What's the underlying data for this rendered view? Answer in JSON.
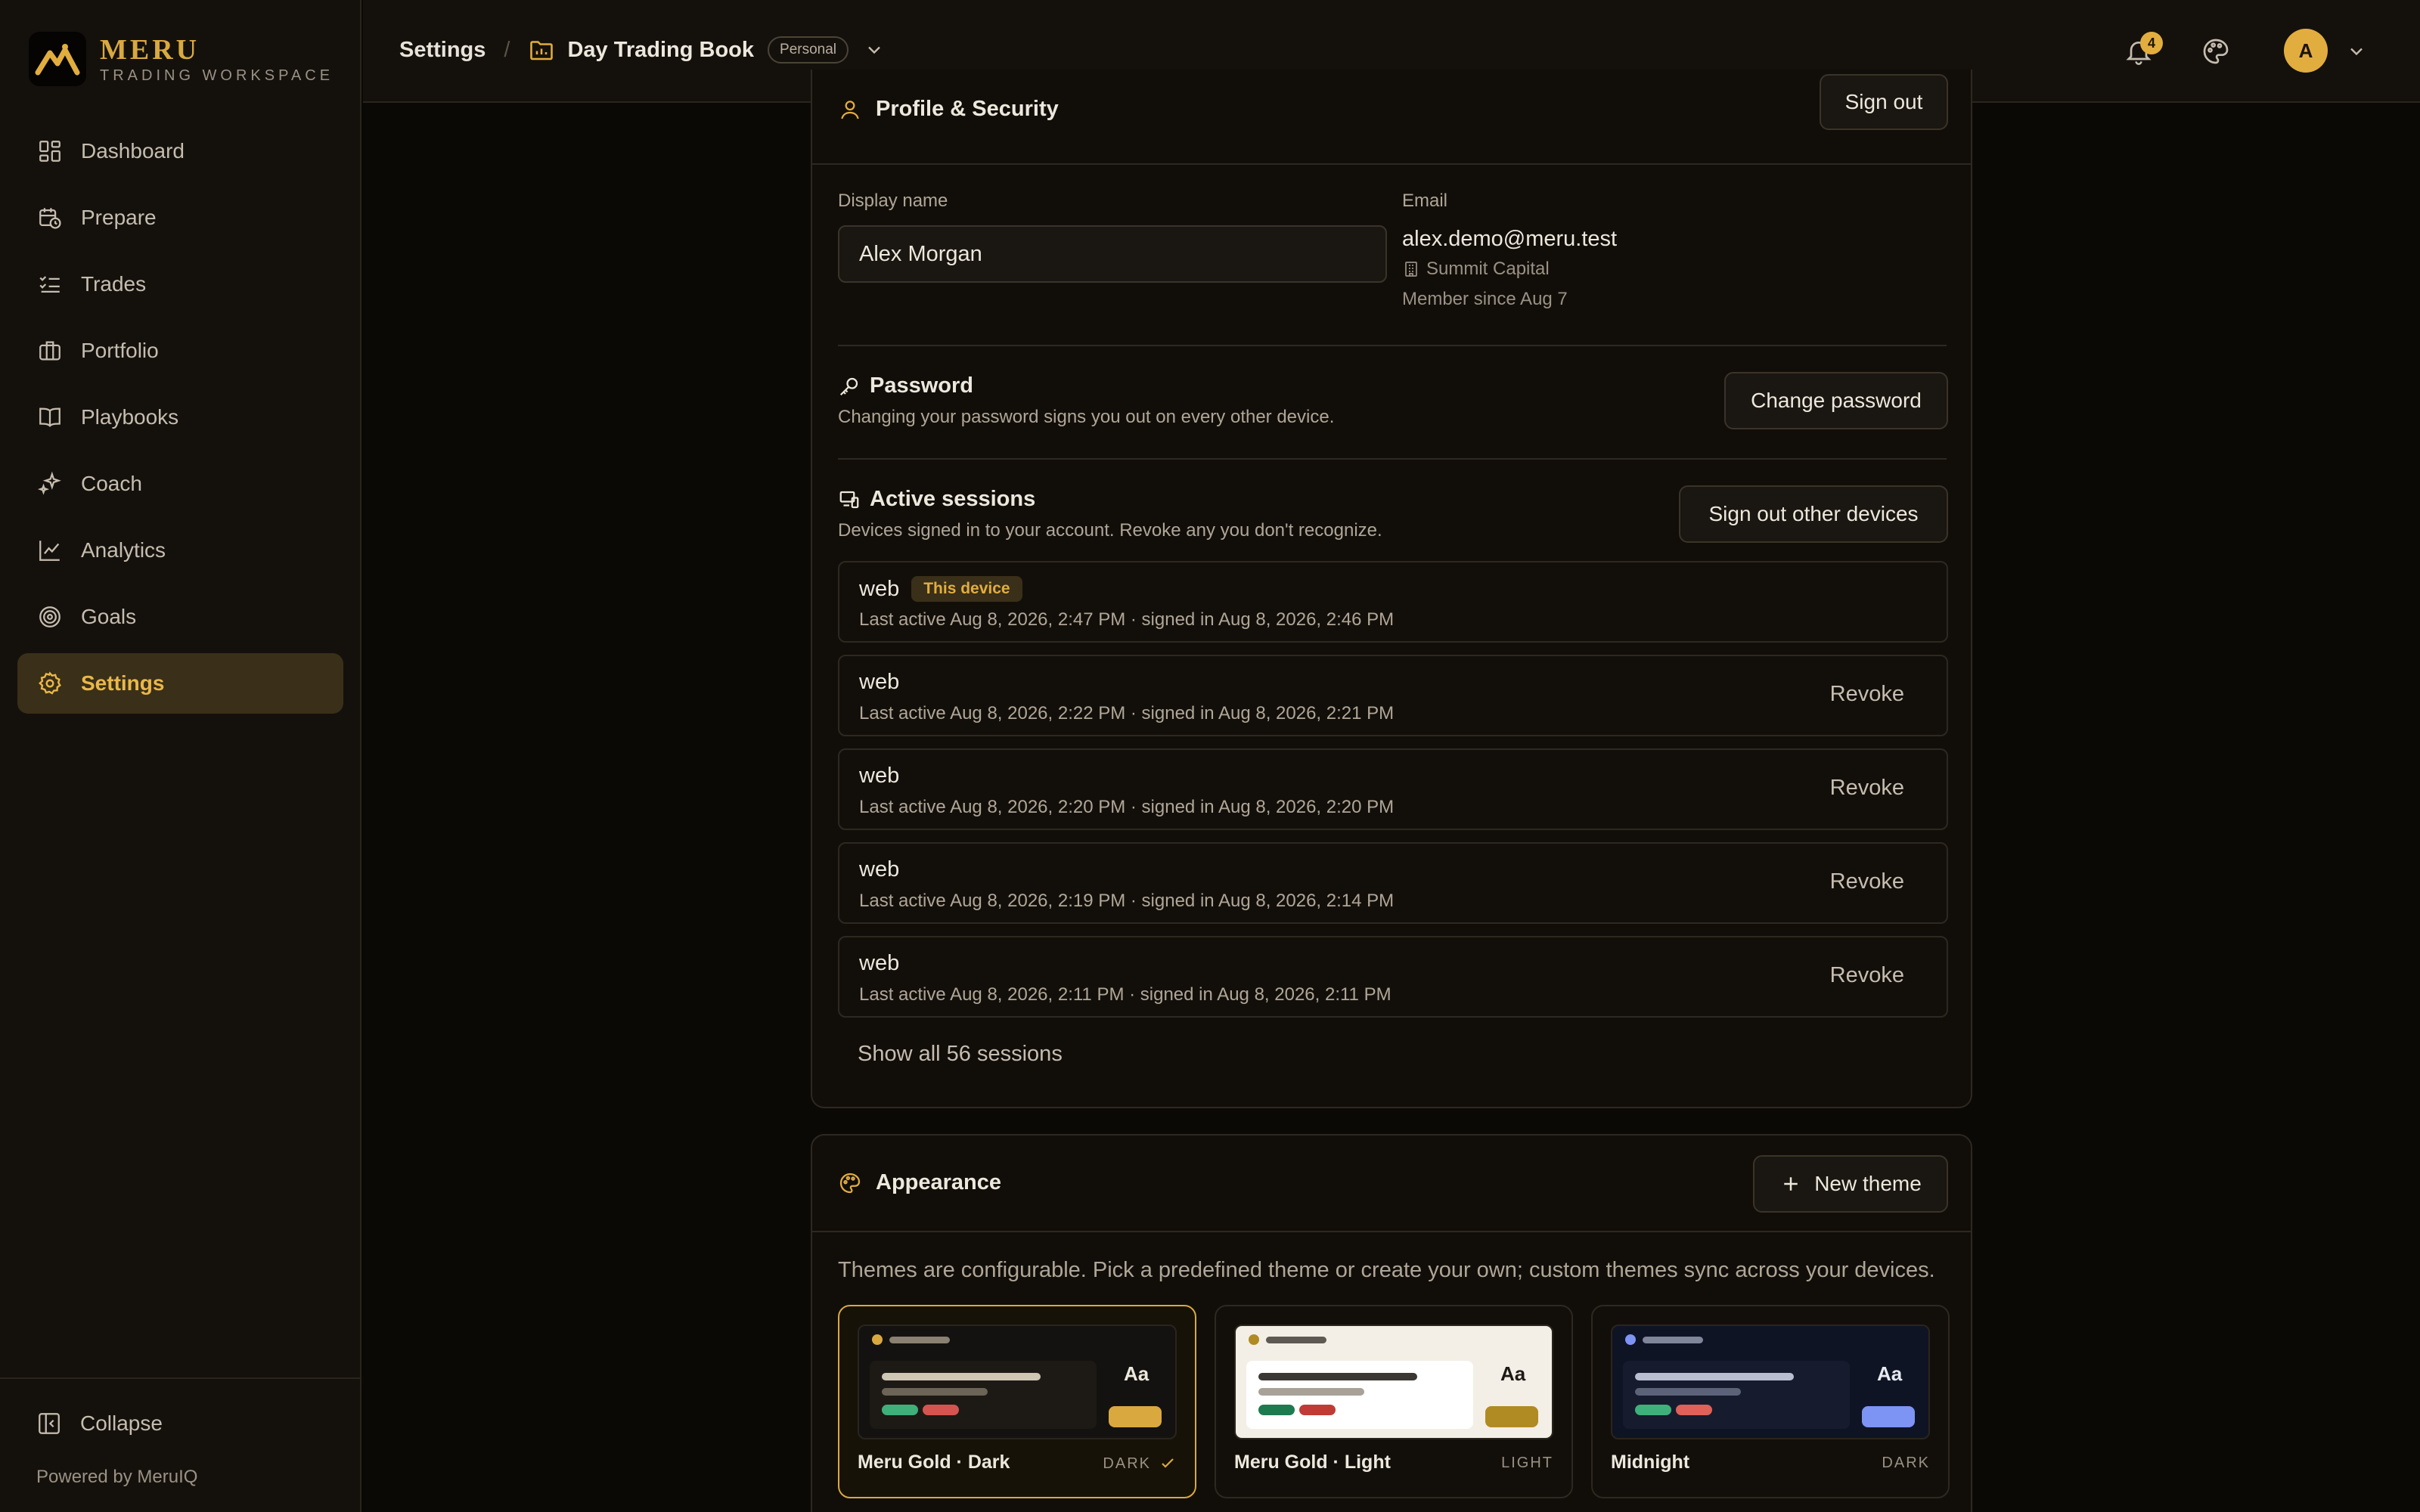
{
  "brand": {
    "name": "MERU",
    "subtitle": "TRADING WORKSPACE"
  },
  "sidebar": {
    "items": [
      {
        "label": "Dashboard",
        "icon": "dashboard-icon"
      },
      {
        "label": "Prepare",
        "icon": "calendar-clock-icon"
      },
      {
        "label": "Trades",
        "icon": "list-check-icon"
      },
      {
        "label": "Portfolio",
        "icon": "briefcase-icon"
      },
      {
        "label": "Playbooks",
        "icon": "book-open-icon"
      },
      {
        "label": "Coach",
        "icon": "sparkles-icon"
      },
      {
        "label": "Analytics",
        "icon": "line-chart-icon"
      },
      {
        "label": "Goals",
        "icon": "target-icon"
      },
      {
        "label": "Settings",
        "icon": "gear-icon",
        "active": true
      }
    ],
    "collapse_label": "Collapse",
    "powered_by": "Powered by MeruIQ"
  },
  "header": {
    "crumb_root": "Settings",
    "separator": "/",
    "book_name": "Day Trading Book",
    "book_badge": "Personal",
    "notification_count": "4",
    "avatar_initial": "A"
  },
  "profile": {
    "title": "Profile & Security",
    "sign_out": "Sign out",
    "display_name_label": "Display name",
    "display_name_value": "Alex Morgan",
    "email_label": "Email",
    "email": "alex.demo@meru.test",
    "company": "Summit Capital",
    "member_since": "Member since Aug 7",
    "password_title": "Password",
    "password_desc": "Changing your password signs you out on every other device.",
    "change_password": "Change password",
    "sessions_title": "Active sessions",
    "sessions_desc": "Devices signed in to your account. Revoke any you don't recognize.",
    "sign_out_others": "Sign out other devices",
    "this_device_label": "This device",
    "revoke_label": "Revoke",
    "sessions": [
      {
        "name": "web",
        "meta": "Last active Aug 8, 2026, 2:47 PM · signed in Aug 8, 2026, 2:46 PM",
        "current": true
      },
      {
        "name": "web",
        "meta": "Last active Aug 8, 2026, 2:22 PM · signed in Aug 8, 2026, 2:21 PM"
      },
      {
        "name": "web",
        "meta": "Last active Aug 8, 2026, 2:20 PM · signed in Aug 8, 2026, 2:20 PM"
      },
      {
        "name": "web",
        "meta": "Last active Aug 8, 2026, 2:19 PM · signed in Aug 8, 2026, 2:14 PM"
      },
      {
        "name": "web",
        "meta": "Last active Aug 8, 2026, 2:11 PM · signed in Aug 8, 2026, 2:11 PM"
      }
    ],
    "show_all": "Show all 56 sessions"
  },
  "appearance": {
    "title": "Appearance",
    "new_theme": "New theme",
    "description": "Themes are configurable. Pick a predefined theme or create your own; custom themes sync across your devices.",
    "themes": [
      {
        "name": "Meru Gold · Dark",
        "mode": "DARK",
        "selected": true,
        "bg": "#141210",
        "panel": "#1d1a16",
        "accent": "#d9a940",
        "line": "#cfc6b4"
      },
      {
        "name": "Meru Gold · Light",
        "mode": "LIGHT",
        "bg": "#f3efe6",
        "panel": "#ffffff",
        "accent": "#b08a22",
        "line": "#3b3833"
      },
      {
        "name": "Midnight",
        "mode": "DARK",
        "bg": "#0f1424",
        "panel": "#161c2e",
        "accent": "#7d94f5",
        "line": "#b9bfd0"
      }
    ],
    "preview_text": "Aa"
  },
  "colors": {
    "accent": "#d9a940",
    "background": "#0b0906",
    "positive": "#3fb07a",
    "negative": "#d6544f"
  }
}
